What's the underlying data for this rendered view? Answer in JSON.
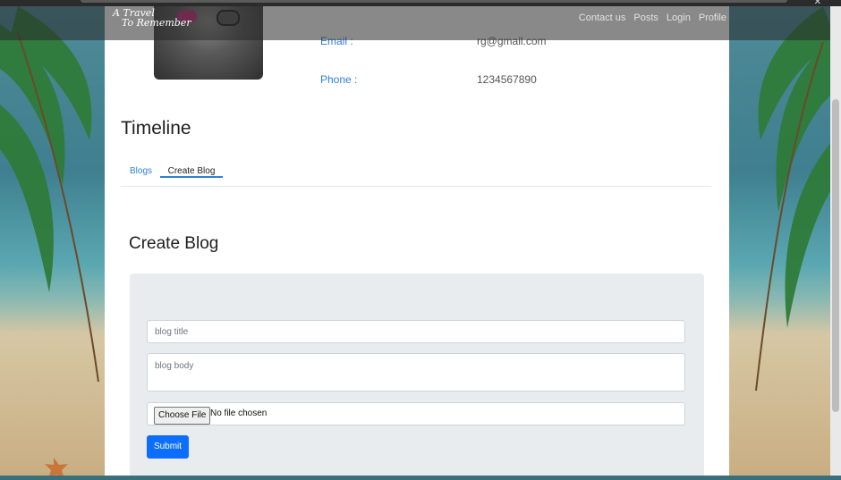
{
  "navbar": {
    "brand_line1": "A Travel",
    "brand_line2": "To Remember",
    "links": [
      "Contact us",
      "Posts",
      "Login",
      "Profile"
    ]
  },
  "profile": {
    "email_label": "Email :",
    "email_value": "rg@gmail.com",
    "phone_label": "Phone :",
    "phone_value": "1234567890"
  },
  "timeline": {
    "title": "Timeline",
    "tabs": [
      "Blogs",
      "Create Blog"
    ],
    "active_tab": "Create Blog"
  },
  "create_blog": {
    "title": "Create Blog",
    "title_placeholder": "blog title",
    "body_placeholder": "blog body",
    "file_button": "Choose File",
    "file_status": "No file chosen",
    "submit_label": "Submit"
  },
  "colors": {
    "accent": "#2f7fd8",
    "submit": "#0d6efd",
    "form_bg": "#e9ecef"
  }
}
